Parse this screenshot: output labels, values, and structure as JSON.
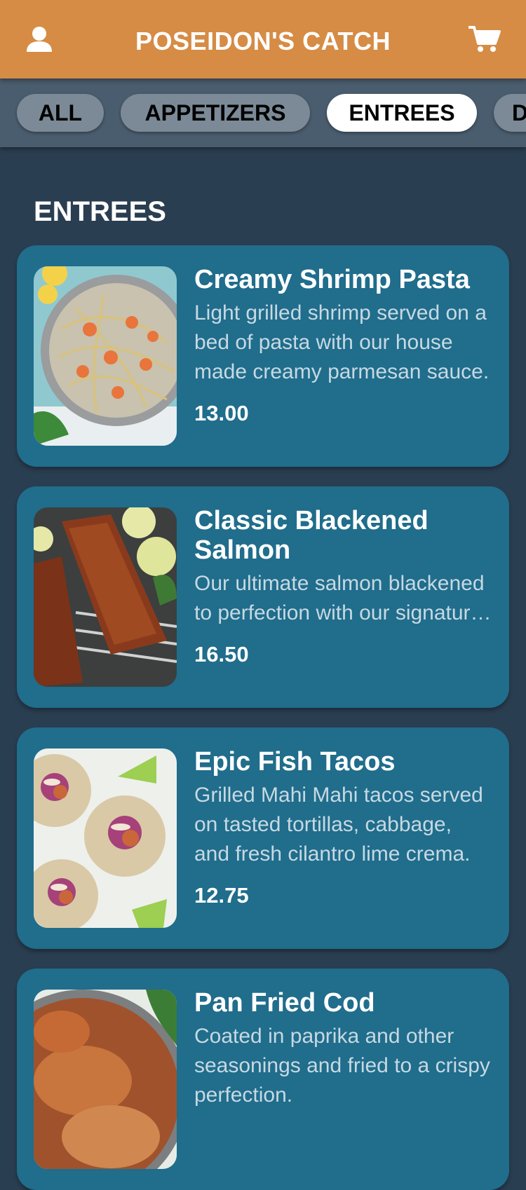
{
  "header": {
    "title": "POSEIDON'S CATCH",
    "user_icon": "user-icon",
    "cart_icon": "cart-icon",
    "background": "#d68c45"
  },
  "tabs": [
    {
      "label": "ALL",
      "active": false
    },
    {
      "label": "APPETIZERS",
      "active": false
    },
    {
      "label": "ENTREES",
      "active": true
    },
    {
      "label": "DESSERTS",
      "active": false
    }
  ],
  "section": {
    "title": "ENTREES"
  },
  "menu_items": [
    {
      "name": "Creamy Shrimp Pasta",
      "description": "Light grilled shrimp served on a bed of pasta with our house made creamy parmesan sauce.",
      "price": "13.00"
    },
    {
      "name": "Classic Blackened Salmon",
      "description": "Our ultimate salmon blackened to perfection with our signature spice blend.",
      "price": "16.50"
    },
    {
      "name": "Epic Fish Tacos",
      "description": "Grilled Mahi Mahi tacos served on tasted tortillas, cabbage, and fresh cilantro lime crema.",
      "price": "12.75"
    },
    {
      "name": "Pan Fried Cod",
      "description": "Coated in paprika and other seasonings and fried to a crispy perfection.",
      "price": ""
    }
  ],
  "colors": {
    "background": "#2a3e51",
    "tabbar": "#4a5d6e",
    "card": "#206d8c",
    "tab_active": "#ffffff",
    "tab_inactive": "#7b8a96"
  }
}
